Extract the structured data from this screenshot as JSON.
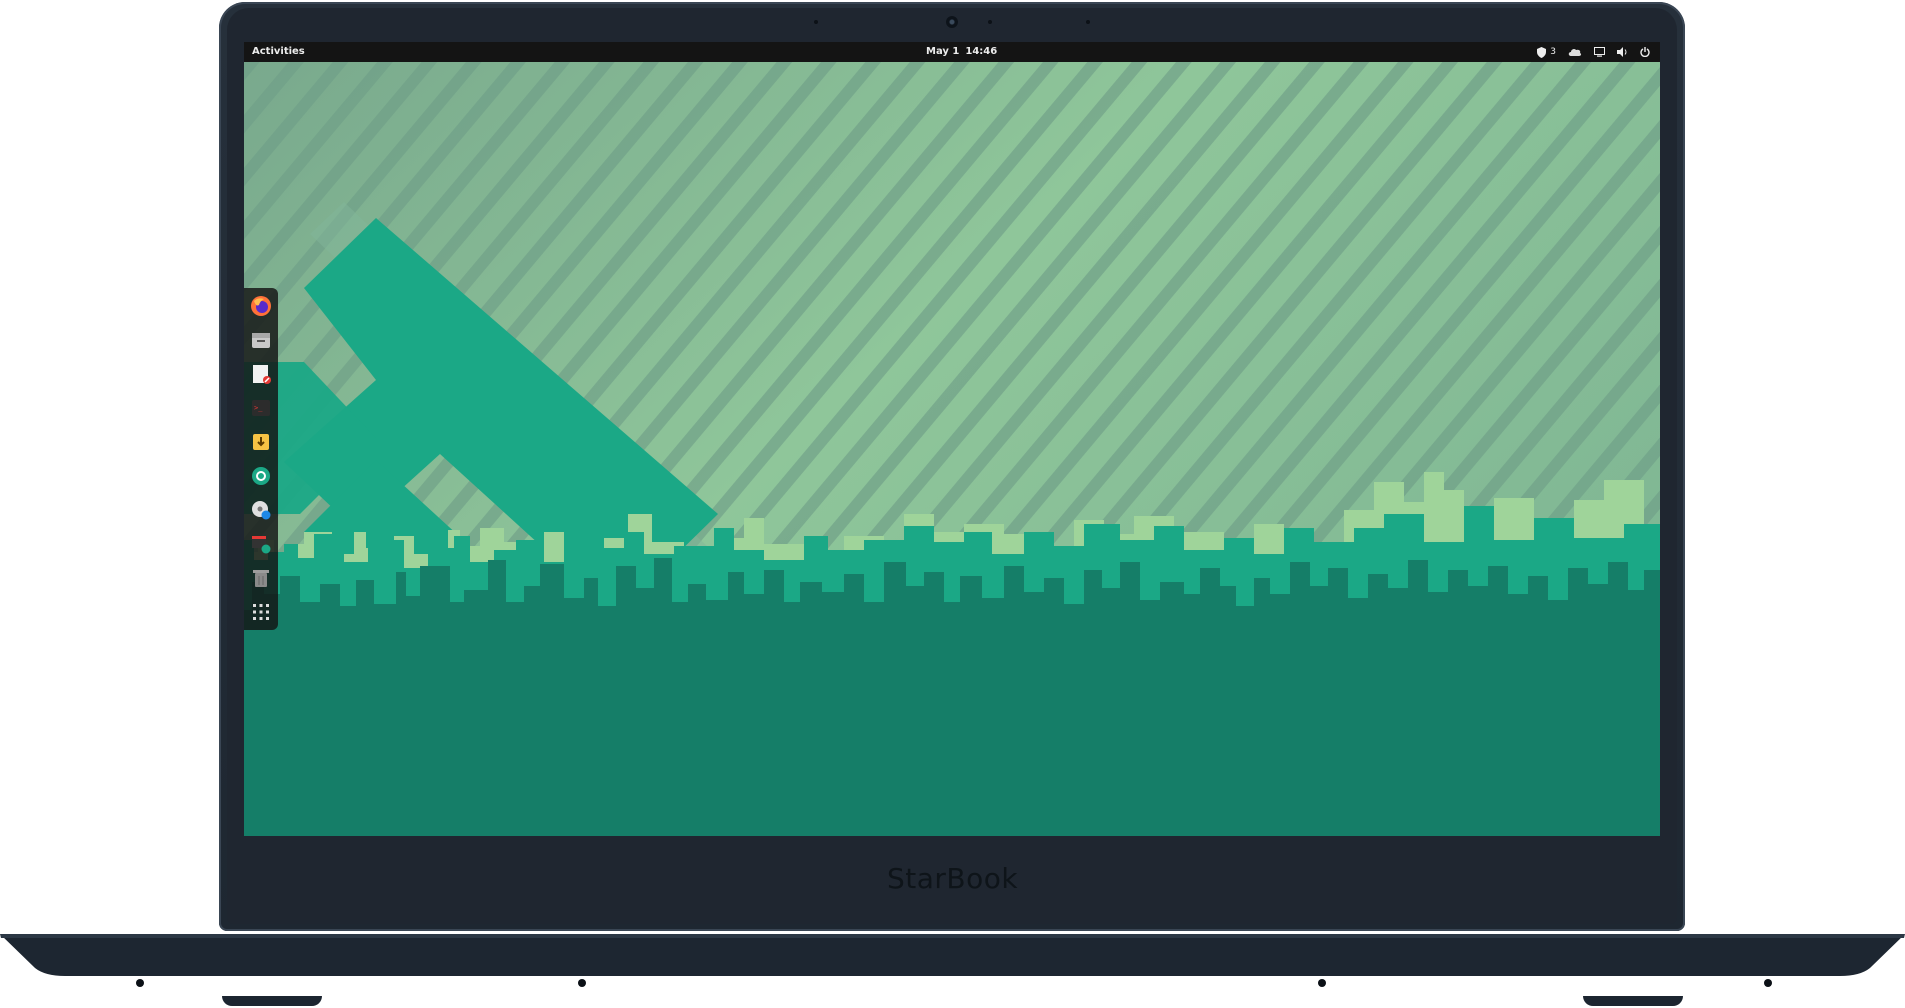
{
  "device": {
    "brand": "StarBook"
  },
  "topbar": {
    "activities_label": "Activities",
    "date": "May 1",
    "time": "14:46",
    "notification_count": "3",
    "tray_icons": [
      "shield-icon",
      "tray-cloud-icon",
      "display-icon",
      "volume-icon",
      "power-icon"
    ]
  },
  "dock": {
    "items": [
      {
        "name": "firefox-icon",
        "label": "Firefox"
      },
      {
        "name": "files-icon",
        "label": "Files"
      },
      {
        "name": "text-editor-icon",
        "label": "Text Editor"
      },
      {
        "name": "terminal-icon",
        "label": "Terminal"
      },
      {
        "name": "software-installer-icon",
        "label": "Software"
      },
      {
        "name": "settings-icon",
        "label": "Settings"
      },
      {
        "name": "disk-utility-icon",
        "label": "Disks"
      },
      {
        "name": "updater-icon",
        "label": "Updates"
      },
      {
        "name": "trash-icon",
        "label": "Trash"
      },
      {
        "name": "app-grid-icon",
        "label": "Show Applications"
      }
    ]
  },
  "colors": {
    "wallpaper_light": "#8cc396",
    "wallpaper_stripe": "#6fa68a",
    "teal": "#1ba886",
    "city_dark": "#157e68",
    "city_mid": "#1b9f80",
    "laptop_body": "#222b36"
  }
}
